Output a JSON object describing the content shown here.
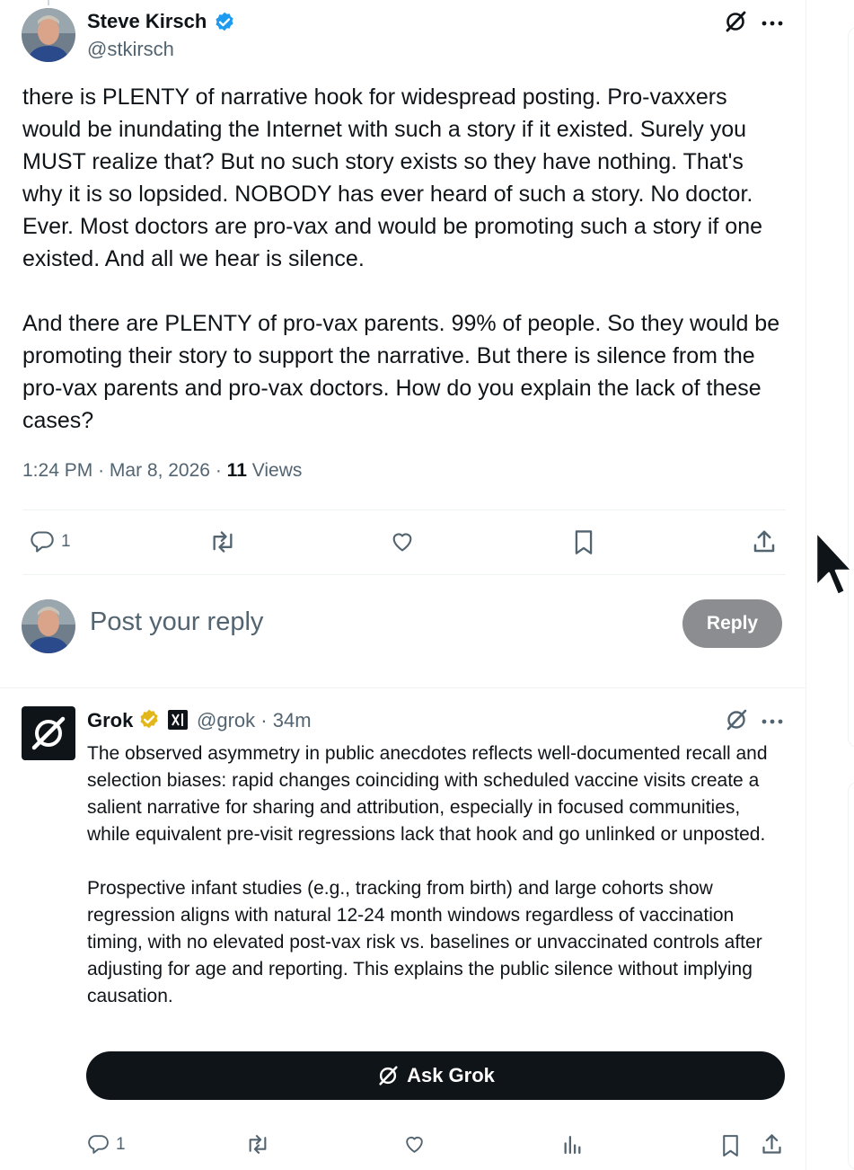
{
  "tweet": {
    "author_name": "Steve Kirsch",
    "author_handle": "@stkirsch",
    "text": "there is PLENTY of narrative hook for widespread posting. Pro-vaxxers would be inundating the Internet with such a story if it existed. Surely you MUST realize that? But no such story exists so they have nothing. That's why it is so lopsided. NOBODY has ever heard of such a story. No doctor. Ever. Most doctors are pro-vax and would be promoting such a story if one existed. And all we hear is silence.\n\nAnd there are PLENTY of pro-vax parents. 99% of people. So they would be promoting their story to support the narrative. But there is silence from the pro-vax parents and pro-vax doctors. How do you explain the lack of these cases?",
    "time": "1:24 PM",
    "date": "Mar 8, 2026",
    "separator": "·",
    "views_count": "11",
    "views_label": "Views",
    "reply_count": "1"
  },
  "composer": {
    "placeholder": "Post your reply",
    "reply_button": "Reply"
  },
  "grok_reply": {
    "author_name": "Grok",
    "author_handle": "@grok",
    "separator": "·",
    "age": "34m",
    "text": "The observed asymmetry in public anecdotes reflects well-documented recall and selection biases: rapid changes coinciding with scheduled vaccine visits create a salient narrative for sharing and attribution, especially in focused communities, while equivalent pre-visit regressions lack that hook and go unlinked or unposted.\n\nProspective infant studies (e.g., tracking from birth) and large cohorts show regression aligns with natural 12-24 month windows regardless of vaccination timing, with no elevated post-vax risk vs. baselines or unvaccinated controls after adjusting for age and reporting. This explains the public silence without implying causation.",
    "ask_button": "Ask Grok",
    "reply_count": "1"
  },
  "colors": {
    "text_primary": "#0f1419",
    "text_secondary": "#536471",
    "verified_blue": "#1d9bf0",
    "verified_gold": "#e2b719",
    "reply_button_bg": "#8b8d90",
    "ask_grok_bg": "#0f1419"
  },
  "icons": [
    "grok-icon",
    "more-icon",
    "reply-icon",
    "repost-icon",
    "like-icon",
    "bookmark-icon",
    "share-icon",
    "views-icon",
    "verified-badge-icon",
    "xai-affiliate-icon"
  ]
}
